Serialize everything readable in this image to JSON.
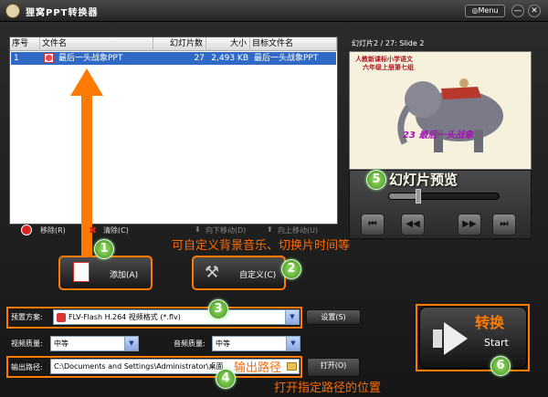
{
  "app": {
    "title": "狸窝PPT转换器",
    "menu_label": "Menu",
    "minimize": "—",
    "close": "✕"
  },
  "filelist": {
    "columns": [
      "序号",
      "文件名",
      "幻灯片数",
      "大小",
      "目标文件名"
    ],
    "rows": [
      {
        "index": "1",
        "filename": "最后一头战象PPT",
        "slides": "27",
        "size": "2,493 KB",
        "target": "最后一头战象PPT"
      }
    ]
  },
  "listbar": {
    "remove": "移除(R)",
    "clear": "清除(C)",
    "move_down": "向下移动(D)",
    "move_up": "向上移动(U)"
  },
  "preview": {
    "header": "幻灯片2 / 27: Slide 2",
    "slide_line1": "人教新课标小学语文",
    "slide_line2": "六年级上册第七组",
    "slide_title": "23 最后一头战象",
    "seek_fraction": 0.28,
    "buttons": [
      "⏮",
      "◀◀",
      "▶▶",
      "⏭"
    ]
  },
  "buttons": {
    "add": "添加(A)",
    "custom": "自定义(C)",
    "settings": "设置(S)",
    "open": "打开(O)",
    "start": "Start"
  },
  "form": {
    "preset_label": "预置方案:",
    "preset_value": "FLV-Flash H.264 视频格式 (*.flv)",
    "video_quality_label": "视频质量:",
    "video_quality_value": "中等",
    "audio_quality_label": "音频质量:",
    "audio_quality_value": "中等",
    "output_label": "输出路径:",
    "output_value": "C:\\Documents and Settings\\Administrator\\桌面"
  },
  "annotations": {
    "n1": "1",
    "n2": "2",
    "n3": "3",
    "n4": "4",
    "n5": "5",
    "n6": "6",
    "custom_note": "可自定义背景音乐、切换片时间等",
    "preview_note": "幻灯片预览",
    "output_note": "输出路径",
    "open_note": "打开指定路径的位置",
    "convert_note": "转换"
  },
  "colors": {
    "selection": "#316ac5",
    "annotation": "#ff7a00",
    "badge": "#5bbf2a"
  }
}
